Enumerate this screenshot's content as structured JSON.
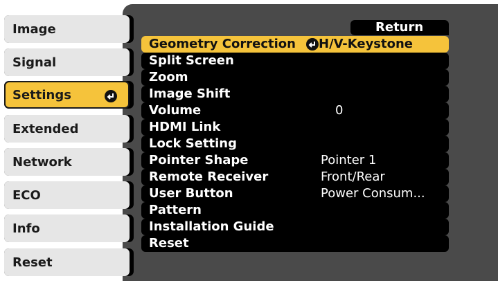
{
  "sidebar": {
    "items": [
      {
        "label": "Image"
      },
      {
        "label": "Signal"
      },
      {
        "label": "Settings",
        "selected": true
      },
      {
        "label": "Extended"
      },
      {
        "label": "Network"
      },
      {
        "label": "ECO"
      },
      {
        "label": "Info"
      },
      {
        "label": "Reset"
      }
    ]
  },
  "menu": {
    "return_label": "Return",
    "items": [
      {
        "label": "Geometry Correction",
        "value": "H/V-Keystone",
        "highlighted": true
      },
      {
        "label": "Split Screen",
        "value": ""
      },
      {
        "label": "Zoom",
        "value": ""
      },
      {
        "label": "Image Shift",
        "value": ""
      },
      {
        "label": "Volume",
        "value": "0"
      },
      {
        "label": "HDMI Link",
        "value": ""
      },
      {
        "label": "Lock Setting",
        "value": ""
      },
      {
        "label": "Pointer Shape",
        "value": "Pointer 1"
      },
      {
        "label": "Remote Receiver",
        "value": "Front/Rear"
      },
      {
        "label": "User Button",
        "value": "Power Consum..."
      },
      {
        "label": "Pattern",
        "value": ""
      },
      {
        "label": "Installation Guide",
        "value": ""
      },
      {
        "label": "Reset",
        "value": ""
      }
    ]
  },
  "icons": {
    "enter": "enter-icon"
  },
  "colors": {
    "highlight": "#f5c33b",
    "panel": "#4a4a4a",
    "row": "#000000",
    "tab": "#e6e6e6"
  }
}
